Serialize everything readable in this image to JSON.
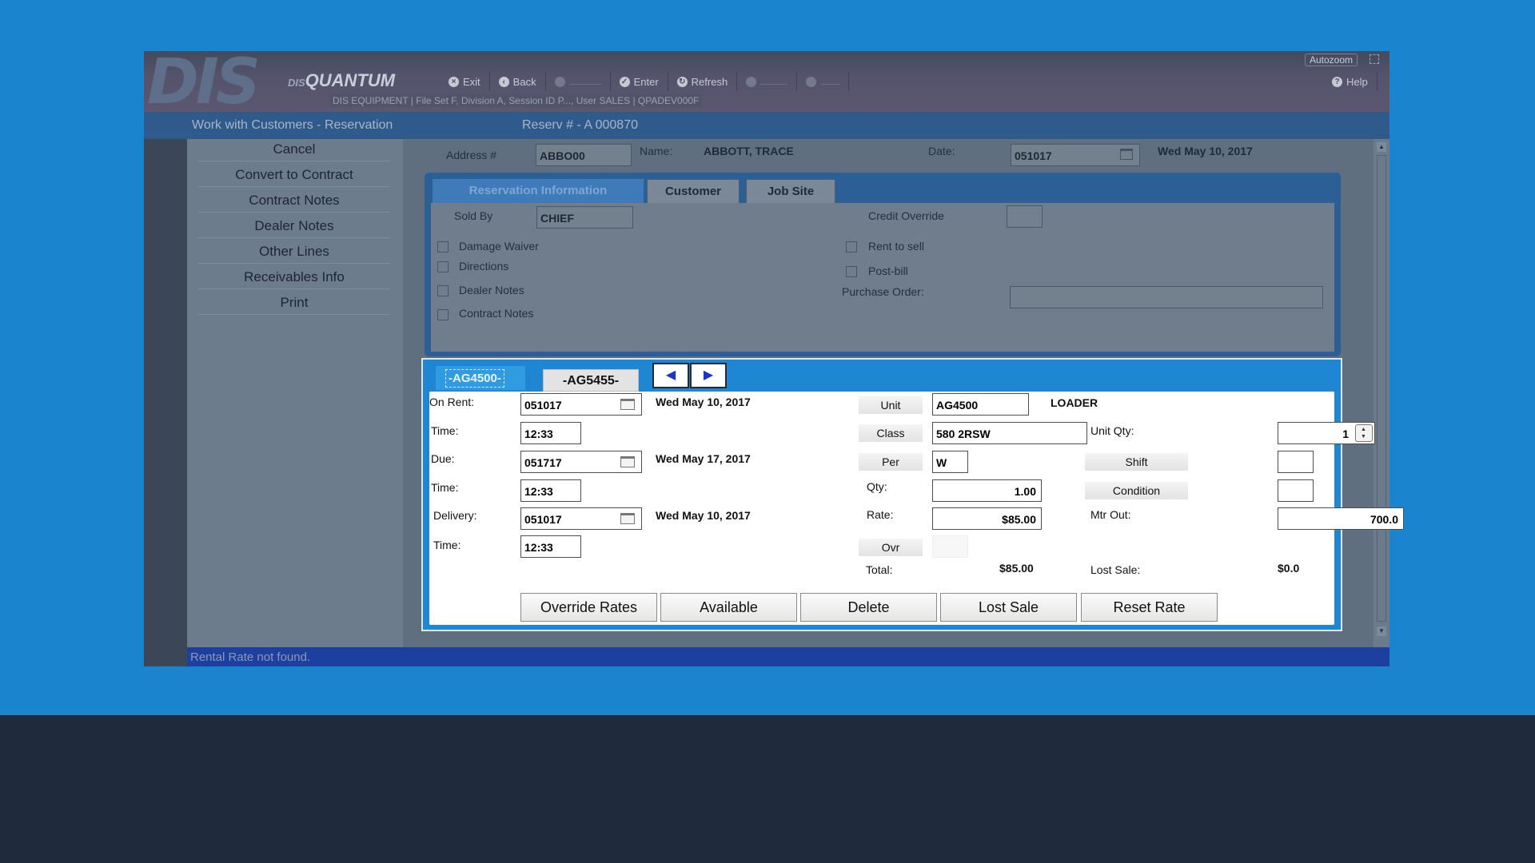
{
  "app": {
    "logo": "DIS",
    "logo_small_prefix": "DIS",
    "logo_small": "QUANTUM",
    "session_info": "DIS EQUIPMENT | File Set F, Division A, Session ID P..., User SALES | QPADEV000F",
    "autozoom": "Autozoom"
  },
  "toolbar": {
    "exit": "Exit",
    "back": "Back",
    "enter": "Enter",
    "refresh": "Refresh",
    "help": "Help"
  },
  "title": {
    "screen": "Work with Customers - Reservation",
    "reservation": "Reserv # - A 000870"
  },
  "sidebar": {
    "items": [
      {
        "label": "Cancel"
      },
      {
        "label": "Convert to Contract"
      },
      {
        "label": "Contract Notes"
      },
      {
        "label": "Dealer Notes"
      },
      {
        "label": "Other Lines"
      },
      {
        "label": "Receivables Info"
      },
      {
        "label": "Print"
      }
    ]
  },
  "header": {
    "address_label": "Address #",
    "address_value": "ABBO00",
    "name_label": "Name:",
    "name_value": "ABBOTT, TRACE",
    "date_label": "Date:",
    "date_value": "051017",
    "date_text": "Wed May 10, 2017"
  },
  "tabs": {
    "reservation": "Reservation Information",
    "customer": "Customer",
    "jobsite": "Job Site"
  },
  "resinfo": {
    "sold_by_label": "Sold By",
    "sold_by_value": "CHIEF",
    "credit_override_label": "Credit Override",
    "damage_waiver": "Damage Waiver",
    "directions": "Directions",
    "dealer_notes": "Dealer Notes",
    "contract_notes": "Contract Notes",
    "rent_to_sell": "Rent to sell",
    "post_bill": "Post-bill",
    "purchase_order_label": "Purchase Order:"
  },
  "unit_tabs": {
    "tab1": "-AG4500-",
    "tab2": "-AG5455-"
  },
  "line": {
    "on_rent_label": "On Rent:",
    "on_rent_value": "051017",
    "on_rent_text": "Wed May 10, 2017",
    "time_label": "Time:",
    "on_rent_time": "12:33",
    "due_label": "Due:",
    "due_value": "051717",
    "due_text": "Wed May 17, 2017",
    "due_time": "12:33",
    "delivery_label": "Delivery:",
    "delivery_value": "051017",
    "delivery_text": "Wed May 10, 2017",
    "delivery_time": "12:33",
    "unit_label": "Unit",
    "unit_value": "AG4500",
    "unit_desc": "LOADER",
    "class_label": "Class",
    "class_value": "580 2RSW",
    "per_label": "Per",
    "per_value": "W",
    "qty_label": "Qty:",
    "qty_value": "1.00",
    "rate_label": "Rate:",
    "rate_value": "$85.00",
    "ovr_label": "Ovr",
    "total_label": "Total:",
    "total_value": "$85.00",
    "unit_qty_label": "Unit Qty:",
    "unit_qty_value": "1",
    "shift_label": "Shift",
    "condition_label": "Condition",
    "mtr_out_label": "Mtr Out:",
    "mtr_out_value": "700.0",
    "lost_sale_label": "Lost Sale:",
    "lost_sale_value": "$0.0"
  },
  "actions": {
    "override_rates": "Override Rates",
    "available": "Available",
    "delete": "Delete",
    "lost_sale": "Lost Sale",
    "reset_rate": "Reset Rate"
  },
  "status": {
    "message": "Rental Rate not found."
  }
}
